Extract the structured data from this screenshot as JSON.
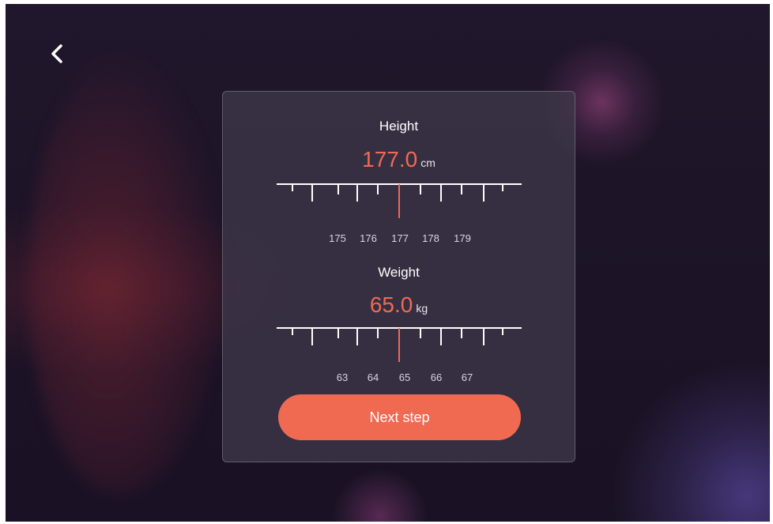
{
  "navigation": {
    "back_icon": "chevron-left-icon"
  },
  "height": {
    "label": "Height",
    "value": "177.0",
    "unit": "cm",
    "ruler_labels": [
      "175",
      "176",
      "177",
      "178",
      "179"
    ],
    "selected": 177
  },
  "weight": {
    "label": "Weight",
    "value": "65.0",
    "unit": "kg",
    "ruler_labels": [
      "63",
      "64",
      "65",
      "66",
      "67"
    ],
    "selected": 65
  },
  "actions": {
    "next_label": "Next step"
  },
  "colors": {
    "accent": "#f06a52",
    "card": "#403a4c",
    "background": "#1d1427"
  }
}
